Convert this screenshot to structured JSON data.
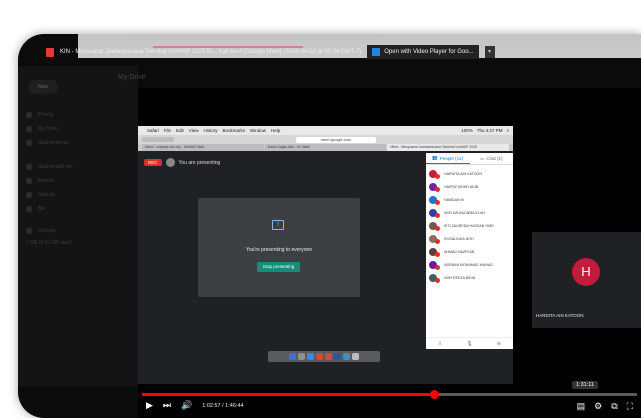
{
  "window": {
    "title": "KIN - Mesyuarat Jawatankuasa Teknikal UniMAP 2025 Bi... Kali ke-4 [Google Meet] (2020-04-02 at 00:24 GMT-7)",
    "open_with": "Open with Video Player for Goo..."
  },
  "drive": {
    "new_label": "New",
    "title": "My Drive",
    "items": [
      "Priority",
      "My Drive",
      "Shared drives",
      "Shared with me",
      "Recent",
      "Starred",
      "Bin",
      "Storage",
      "1 GB of 15 GB used"
    ]
  },
  "mac": {
    "menu": [
      "Safari",
      "File",
      "Edit",
      "View",
      "History",
      "Bookmarks",
      "Window",
      "Help"
    ],
    "clock": "Thu 4:27 PM",
    "battery": "100%",
    "url": "meet.google.com",
    "tabs": [
      "Inbox - unimap.edu.my - UniMAP Mail",
      "Harta Ungku Abu - M Salim",
      "Meet - Mesyuarat Jawatankuasa Teknikal UniMAP 2025"
    ]
  },
  "meet": {
    "rec": "REC",
    "you_presenting": "You are presenting",
    "presenting_to_everyone": "You're presenting to everyone",
    "stop_presenting": "Stop presenting",
    "people_tab": "People (14)",
    "chat_tab": "Chat (1)",
    "participants": [
      {
        "name": "HARDITA AIN KATOON",
        "color": "#c21c3a"
      },
      {
        "name": "HAFRIZ MOHD ADIB",
        "color": "#7b1fa2"
      },
      {
        "name": "HAMDAN M",
        "color": "#1976d2"
      },
      {
        "name": "NOR AZLINA ABDULLAH",
        "color": "#303f9f"
      },
      {
        "name": "SITI ZAUREDA HASSAN GMD",
        "color": "#795548"
      },
      {
        "name": "ROSALINDA NOH",
        "color": "#8d6e63"
      },
      {
        "name": "AHMAD NAZRI AB",
        "color": "#5d4037"
      },
      {
        "name": "NORAINI MOHAMAD MUHAD",
        "color": "#6a1b9a"
      },
      {
        "name": "NOR REEZA BIDIN",
        "color": "#455a64"
      }
    ],
    "tile_initial": "H",
    "tile_name": "HARDITA AIN KATOON"
  },
  "player": {
    "time": "1:02:57 / 1:46:44",
    "tooltip": "1:31:11",
    "progress": 0.59
  }
}
